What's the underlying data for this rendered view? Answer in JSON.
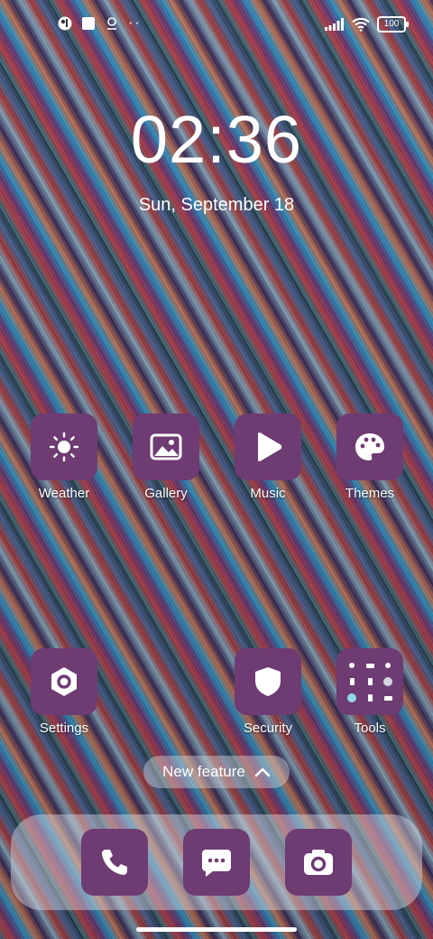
{
  "status_bar": {
    "left_icons": [
      "camera-app-icon",
      "square-notification-icon",
      "location-pin-icon",
      "more-dots-icon"
    ],
    "more_dots": "··",
    "battery": "100",
    "right_icons": [
      "signal-bars-icon",
      "wifi-icon",
      "battery-icon"
    ]
  },
  "clock": {
    "time": "02:36",
    "date": "Sun, September 18"
  },
  "apps": {
    "weather": "Weather",
    "gallery": "Gallery",
    "music": "Music",
    "themes": "Themes",
    "settings": "Settings",
    "security": "Security",
    "tools": "Tools"
  },
  "new_feature": {
    "label": "New feature"
  },
  "dock": {
    "items": [
      "phone-icon",
      "messages-icon",
      "camera-icon"
    ]
  },
  "colors": {
    "tile": "#6e3b72"
  }
}
